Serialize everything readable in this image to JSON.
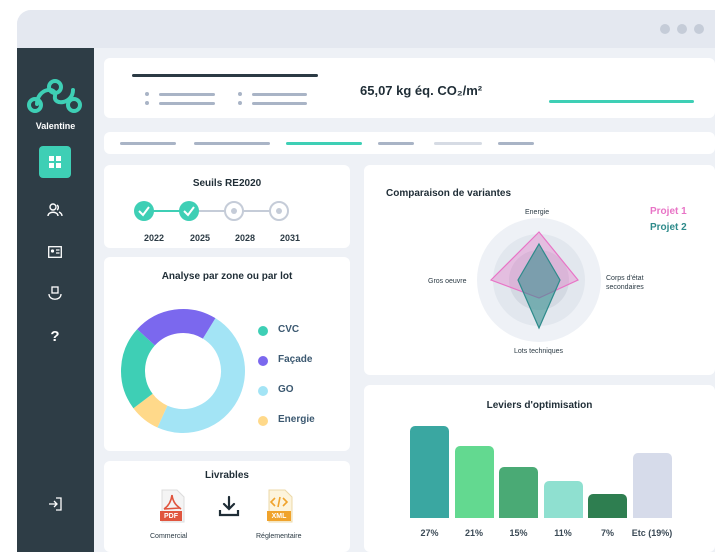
{
  "user": {
    "name": "Valentine"
  },
  "header": {
    "value": "65,07 kg éq. CO₂/m²"
  },
  "thresholds": {
    "title": "Seuils RE2020",
    "years": [
      {
        "label": "2022",
        "done": true
      },
      {
        "label": "2025",
        "done": true
      },
      {
        "label": "2028",
        "done": false
      },
      {
        "label": "2031",
        "done": false
      }
    ]
  },
  "zone": {
    "title": "Analyse par zone ou par lot",
    "legend": [
      {
        "label": "CVC",
        "color": "#3ecfb5"
      },
      {
        "label": "Façade",
        "color": "#7b68ee"
      },
      {
        "label": "GO",
        "color": "#a3e4f5"
      },
      {
        "label": "Energie",
        "color": "#ffd98a"
      }
    ]
  },
  "deliverables": {
    "title": "Livrables",
    "items": [
      {
        "label": "Commercial",
        "badge": "PDF"
      },
      {
        "label": "Réglementaire",
        "badge": "XML"
      }
    ]
  },
  "variants": {
    "title": "Comparaison de variantes",
    "axes": [
      "Energie",
      "Corps d'état secondaires",
      "Lots techniques",
      "Gros oeuvre"
    ],
    "axis_line1": "Corps d'état",
    "axis_line2": "secondaires",
    "legend": [
      {
        "label": "Projet 1",
        "color": "#e874c6"
      },
      {
        "label": "Projet 2",
        "color": "#2e8b8b"
      }
    ]
  },
  "levers": {
    "title": "Leviers d'optimisation",
    "labels": [
      "27%",
      "21%",
      "15%",
      "11%",
      "7%",
      "Etc (19%)"
    ]
  },
  "chart_data": [
    {
      "type": "pie",
      "categories": [
        "CVC",
        "Façade",
        "GO",
        "Energie"
      ],
      "values": [
        22,
        22,
        48,
        8
      ],
      "title": "Analyse par zone ou par lot"
    },
    {
      "type": "bar",
      "categories": [
        "27%",
        "21%",
        "15%",
        "11%",
        "7%",
        "Etc (19%)"
      ],
      "values": [
        27,
        21,
        15,
        11,
        7,
        19
      ],
      "colors": [
        "#3aa7a1",
        "#63d990",
        "#4aaa75",
        "#8fe0d0",
        "#2e7e50",
        "#d6dbea"
      ],
      "title": "Leviers d'optimisation"
    },
    {
      "type": "radar",
      "title": "Comparaison de variantes",
      "axes": [
        "Energie",
        "Corps d'état secondaires",
        "Lots techniques",
        "Gros oeuvre"
      ],
      "series": [
        {
          "name": "Projet 1",
          "values": [
            0.8,
            0.65,
            0.3,
            0.8
          ]
        },
        {
          "name": "Projet 2",
          "values": [
            0.6,
            0.35,
            0.8,
            0.35
          ]
        }
      ]
    }
  ]
}
